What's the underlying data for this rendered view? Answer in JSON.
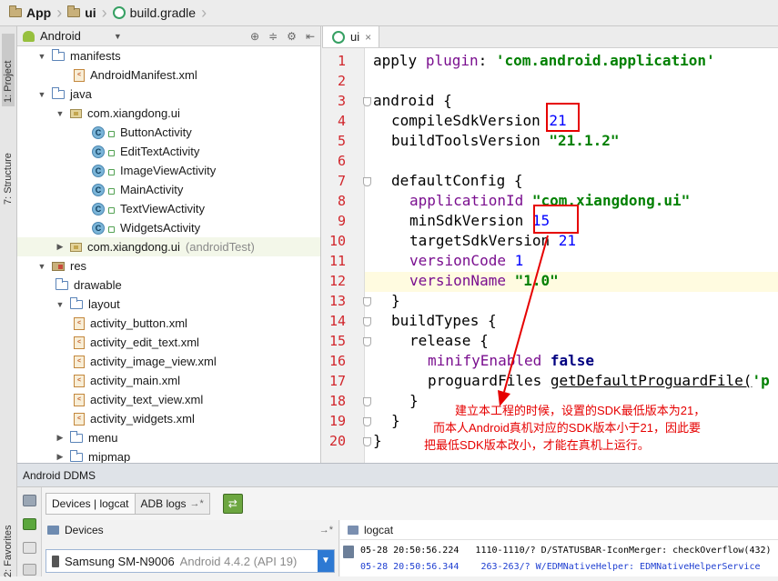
{
  "breadcrumb": {
    "items": [
      "App",
      "ui",
      "build.gradle"
    ]
  },
  "side_tabs": {
    "project": "1: Project",
    "structure": "7: Structure",
    "favorites": "2: Favorites"
  },
  "project_panel": {
    "view_selector": "Android",
    "tree": [
      {
        "label": "manifests",
        "note": "",
        "icon": "folder-icon",
        "expanded": true
      },
      {
        "label": "AndroidManifest.xml",
        "note": "",
        "icon": "xml-file-icon"
      },
      {
        "label": "java",
        "note": "",
        "icon": "folder-icon",
        "expanded": true
      },
      {
        "label": "com.xiangdong.ui",
        "note": "",
        "icon": "package-icon",
        "expanded": true
      },
      {
        "label": "ButtonActivity",
        "note": "",
        "icon": "class-icon"
      },
      {
        "label": "EditTextActivity",
        "note": "",
        "icon": "class-icon"
      },
      {
        "label": "ImageViewActivity",
        "note": "",
        "icon": "class-icon"
      },
      {
        "label": "MainActivity",
        "note": "",
        "icon": "class-icon"
      },
      {
        "label": "TextViewActivity",
        "note": "",
        "icon": "class-icon"
      },
      {
        "label": "WidgetsActivity",
        "note": "",
        "icon": "class-icon"
      },
      {
        "label": "com.xiangdong.ui",
        "note": "(androidTest)",
        "icon": "package-icon",
        "expanded": false
      },
      {
        "label": "res",
        "note": "",
        "icon": "res-folder-icon",
        "expanded": true
      },
      {
        "label": "drawable",
        "note": "",
        "icon": "folder-icon"
      },
      {
        "label": "layout",
        "note": "",
        "icon": "folder-icon",
        "expanded": true
      },
      {
        "label": "activity_button.xml",
        "note": "",
        "icon": "xml-file-icon"
      },
      {
        "label": "activity_edit_text.xml",
        "note": "",
        "icon": "xml-file-icon"
      },
      {
        "label": "activity_image_view.xml",
        "note": "",
        "icon": "xml-file-icon"
      },
      {
        "label": "activity_main.xml",
        "note": "",
        "icon": "xml-file-icon"
      },
      {
        "label": "activity_text_view.xml",
        "note": "",
        "icon": "xml-file-icon"
      },
      {
        "label": "activity_widgets.xml",
        "note": "",
        "icon": "xml-file-icon"
      },
      {
        "label": "menu",
        "note": "",
        "icon": "folder-icon",
        "expanded": false
      },
      {
        "label": "mipmap",
        "note": "",
        "icon": "folder-icon",
        "expanded": false
      }
    ]
  },
  "editor": {
    "tab_label": "ui",
    "tab_close": "×",
    "line_numbers": [
      "1",
      "2",
      "3",
      "4",
      "5",
      "6",
      "7",
      "8",
      "9",
      "10",
      "11",
      "12",
      "13",
      "14",
      "15",
      "16",
      "17",
      "18",
      "19",
      "20"
    ],
    "code": {
      "l1_kw": "apply",
      "l1_id": "plugin",
      "l1_colon": ": ",
      "l1_str": "'com.android.application'",
      "l3": "android {",
      "l4_id": "compileSdkVersion",
      "l4_num": "21",
      "l5_id": "buildToolsVersion",
      "l5_str": "\"21.1.2\"",
      "l7": "defaultConfig {",
      "l8_id": "applicationId",
      "l8_str": "\"com.xiangdong.ui\"",
      "l9_id": "minSdkVersion",
      "l9_num": "15",
      "l10_id": "targetSdkVersion",
      "l10_num": "21",
      "l11_id": "versionCode",
      "l11_num": "1",
      "l12_id": "versionName",
      "l12_str": "\"1.0\"",
      "l13": "}",
      "l14": "buildTypes {",
      "l15": "release {",
      "l16_id": "minifyEnabled",
      "l16_kw": "false",
      "l17_id": "proguardFiles",
      "l17_call": "getDefaultProguardFile(",
      "l17_str": "'p",
      "l18": "}",
      "l19": "}",
      "l20": "}"
    },
    "annotation": [
      "建立本工程的时候，设置的SDK最低版本为21，",
      "而本人Android真机对应的SDK版本小于21，因此要",
      "把最低SDK版本改小，才能在真机上运行。"
    ]
  },
  "ddms": {
    "title": "Android DDMS",
    "tabs": [
      "Devices | logcat",
      "ADB logs"
    ],
    "adb_suffix": "→*",
    "devices_label": "Devices",
    "devices_suffix": "→*",
    "device_name": "Samsung SM-N9006",
    "device_os": "Android 4.4.2 (API 19)",
    "logcat_label": "logcat",
    "log_lines": [
      "05-28 20:50:56.224   1110-1110/? D/STATUSBAR-IconMerger: checkOverflow(432)",
      "05-28 20:50:56.344    263-263/? W/EDMNativeHelper: EDMNativeHelperService"
    ]
  },
  "colors": {
    "annotation_red": "#e60000",
    "string_green": "#008000",
    "number_blue": "#0000ff",
    "line_number_red": "#d1252b"
  }
}
